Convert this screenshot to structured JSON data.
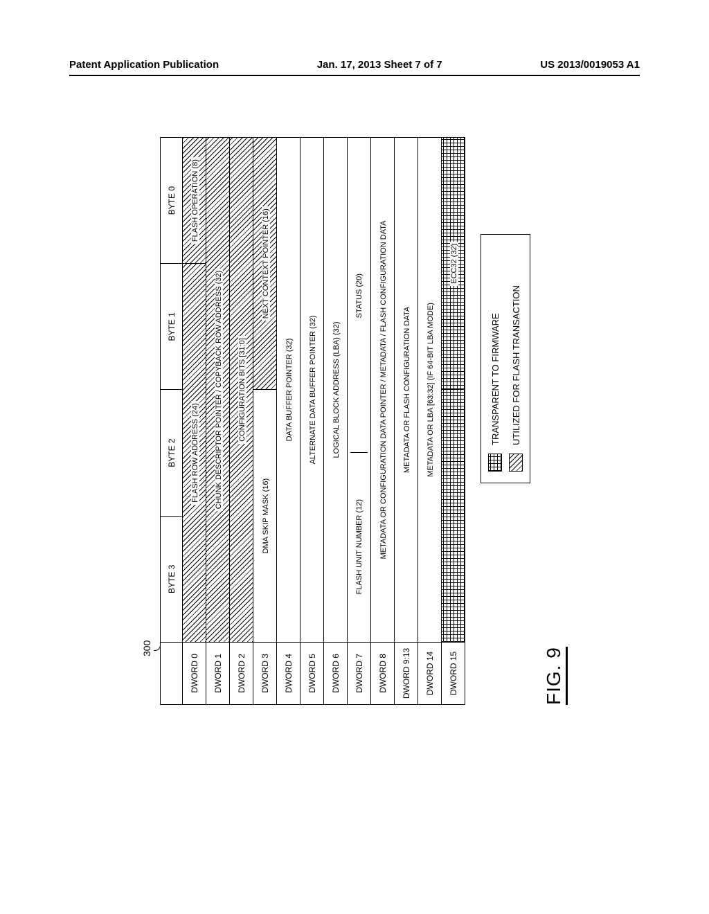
{
  "header": {
    "left": "Patent Application Publication",
    "center": "Jan. 17, 2013  Sheet 7 of 7",
    "right": "US 2013/0019053 A1"
  },
  "figure": {
    "ref_number": "300",
    "label": "FIG. 9"
  },
  "columns": {
    "blank": "",
    "b3": "BYTE 3",
    "b2": "BYTE 2",
    "b1": "BYTE 1",
    "b0": "BYTE 0"
  },
  "rows": [
    {
      "label": "DWORD 0"
    },
    {
      "label": "DWORD 1"
    },
    {
      "label": "DWORD 2"
    },
    {
      "label": "DWORD 3"
    },
    {
      "label": "DWORD 4"
    },
    {
      "label": "DWORD 5"
    },
    {
      "label": "DWORD 6"
    },
    {
      "label": "DWORD 7"
    },
    {
      "label": "DWORD 8"
    },
    {
      "label": "DWORD 9:13"
    },
    {
      "label": "DWORD 14"
    },
    {
      "label": "DWORD 15"
    }
  ],
  "cells": {
    "d0_a": "FLASH ROW ADDRESS (24)",
    "d0_b": "FLASH OPERATION (8)",
    "d1": "CHUNK DESCRIPTOR POINTER / COPYBACK ROW ADDRESS (32)",
    "d2": "CONFIGURATION BITS [31:0]",
    "d3_a": "DMA SKIP MASK (16)",
    "d3_b": "NEXT CONTEXT POINTER (16)",
    "d4": "DATA BUFFER POINTER (32)",
    "d5": "ALTERNATE DATA BUFFER POINTER (32)",
    "d6": "LOGICAL BLOCK ADDRESS (LBA) (32)",
    "d7_a": "FLASH UNIT NUMBER (12)",
    "d7_b": "STATUS (20)",
    "d8": "METADATA OR CONFIGURATION DATA POINTER / METADATA / FLASH CONFIGURATION DATA",
    "d913": "METADATA OR FLASH CONFIGURATION DATA",
    "d14": "METADATA OR LBA [63:32] (IF 64-BIT LBA MODE)",
    "d15_a": "",
    "d15_b": "ECC32 (32)"
  },
  "legend": {
    "transparent": "TRANSPARENT TO FIRMWARE",
    "utilized": "UTILIZED FOR FLASH TRANSACTION"
  }
}
